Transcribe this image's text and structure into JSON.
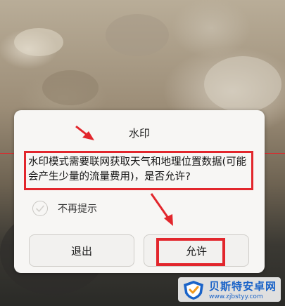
{
  "dialog": {
    "title": "水印",
    "message": "水印模式需要联网获取天气和地理位置数据(可能会产生少量的流量费用)，是否允许?",
    "checkbox_label": "不再提示",
    "checkbox_checked": false,
    "buttons": {
      "exit_label": "退出",
      "allow_label": "允许"
    }
  },
  "annotation": {
    "highlight_color": "#e2262c",
    "line_color": "#e0262b"
  },
  "watermark": {
    "name": "贝斯特安卓网",
    "url": "www.zjbstyy.com",
    "logo_icon": "shield-logo-icon"
  }
}
